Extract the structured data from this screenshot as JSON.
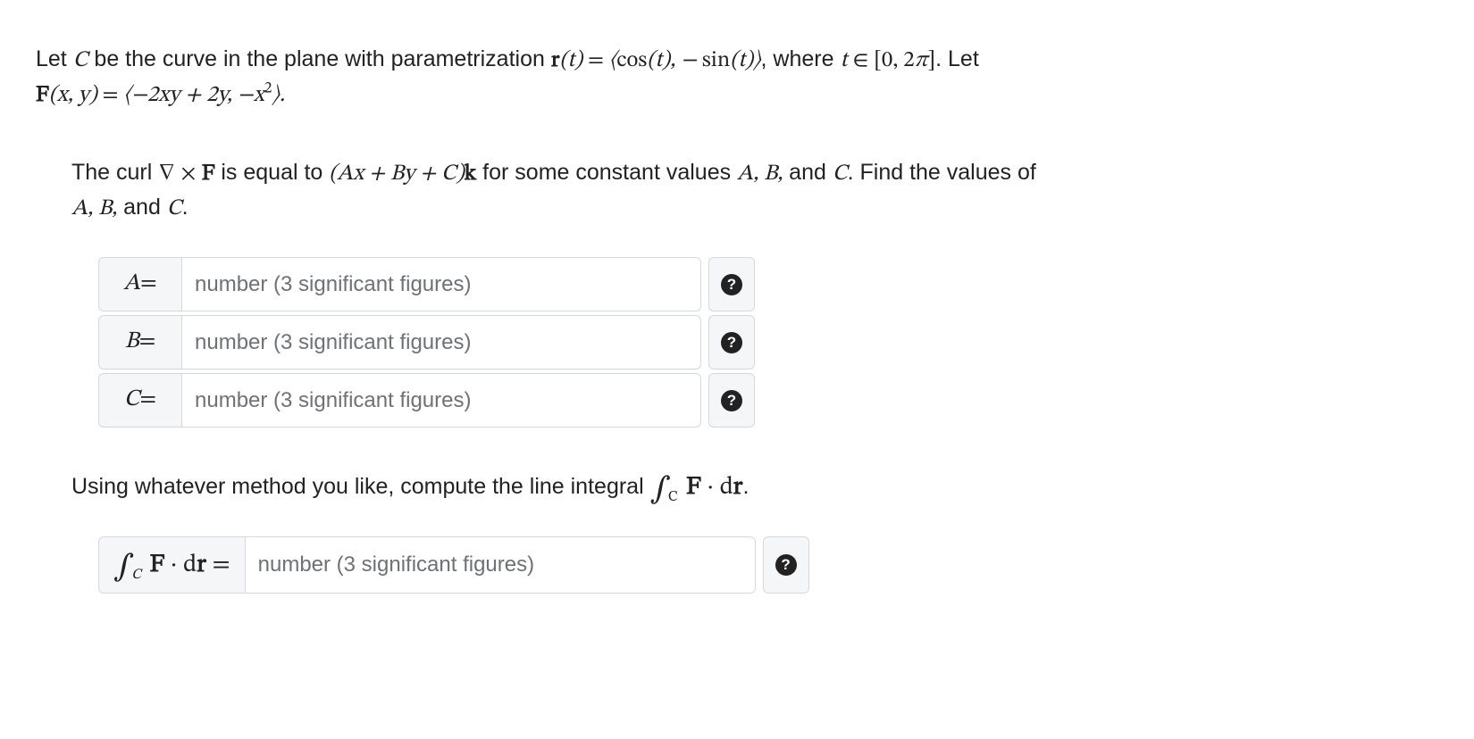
{
  "intro": {
    "pre": "Let ",
    "C": "C",
    "t1": " be the curve in the plane with parametrization ",
    "r_eq": "r(t) = ⟨cos(t), − sin(t)⟩",
    "t2": ", where ",
    "t_in": "t ∈ [0, 2π]",
    "t3": ". Let",
    "F_eq": "F(x, y) = ⟨−2xy + 2y, −x²⟩."
  },
  "prompt1": {
    "p1": "The curl ",
    "curl": "∇ × F",
    "p2": " is equal to ",
    "expr": "(Ax + By + C)k",
    "p3": " for some constant values ",
    "ABC1": "A, B,",
    "p4": " and ",
    "Cv": "C",
    "p5": ". Find the values of",
    "line2a": "A, B,",
    "line2b": " and ",
    "line2c": "C",
    "line2d": "."
  },
  "inputs": {
    "A": {
      "label_var": "A",
      "eq": " =",
      "placeholder": "number (3 significant figures)"
    },
    "B": {
      "label_var": "B",
      "eq": " =",
      "placeholder": "number (3 significant figures)"
    },
    "C": {
      "label_var": "C",
      "eq": " =",
      "placeholder": "number (3 significant figures)"
    }
  },
  "prompt2": {
    "p1": "Using whatever method you like, compute the line integral ",
    "int_sym": "∫",
    "int_sub": "C",
    "int_body": " F · dr",
    "p2": "."
  },
  "input_integral": {
    "int_sym": "∫",
    "int_sub": "C",
    "int_body": " F · dr =",
    "placeholder": "number (3 significant figures)"
  },
  "help_glyph": "?"
}
